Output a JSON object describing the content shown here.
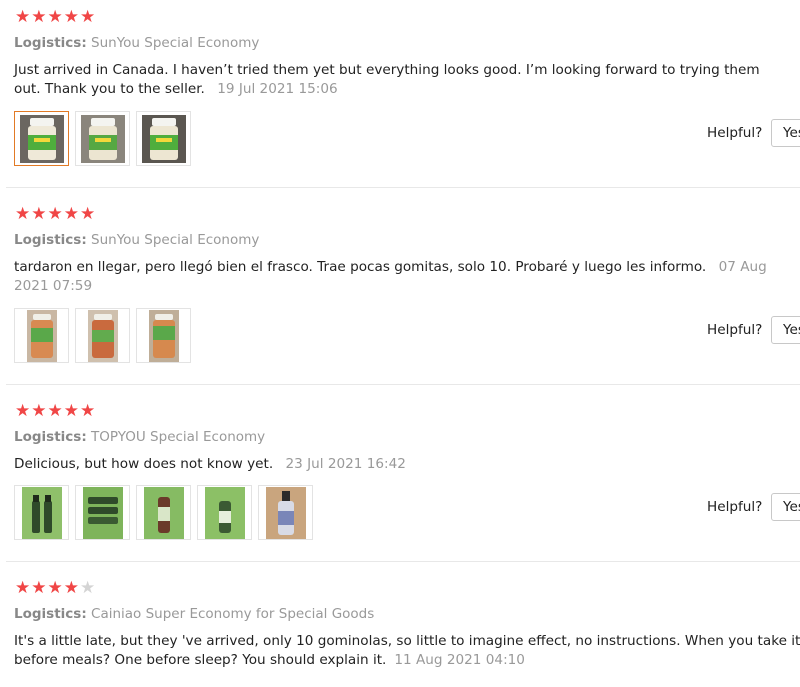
{
  "reviews": [
    {
      "rating": 5,
      "logistics_label": "Logistics:",
      "logistics_value": "SunYou Special Economy",
      "comment": "Just arrived in Canada. I haven’t tried them yet but everything looks good. I’m looking forward to trying them out. Thank you to the seller.",
      "date": "19 Jul 2021 15:06",
      "photo_count": 3,
      "helpful_label": "Helpful?",
      "yes_label": "Yes"
    },
    {
      "rating": 5,
      "logistics_label": "Logistics:",
      "logistics_value": "SunYou Special Economy",
      "comment": "tardaron en llegar, pero llegó bien el frasco. Trae pocas gomitas, solo 10. Probaré y luego les informo.",
      "date": "07 Aug 2021 07:59",
      "photo_count": 3,
      "helpful_label": "Helpful?",
      "yes_label": "Yes"
    },
    {
      "rating": 5,
      "logistics_label": "Logistics:",
      "logistics_value": "TOPYOU Special Economy",
      "comment": "Delicious, but how does not know yet.",
      "date": "23 Jul 2021 16:42",
      "photo_count": 5,
      "helpful_label": "Helpful?",
      "yes_label": "Yes"
    },
    {
      "rating": 4,
      "logistics_label": "Logistics:",
      "logistics_value": "Cainiao Super Economy for Special Goods",
      "comment_line1": "It's a little late, but they 've arrived, only 10 gominolas, so little to imagine effect, no instructions. When you take it? One",
      "comment_line2": "before meals? One before sleep? You should explain it.",
      "date": "11 Aug 2021 04:10"
    }
  ],
  "colors": {
    "star_on": "#f04646",
    "star_off": "#d4d4d4",
    "muted_text": "#999999",
    "active_thumb_border": "#e27a25"
  },
  "icons": {
    "star": "star-icon",
    "photo": "product-photo-thumbnail"
  }
}
